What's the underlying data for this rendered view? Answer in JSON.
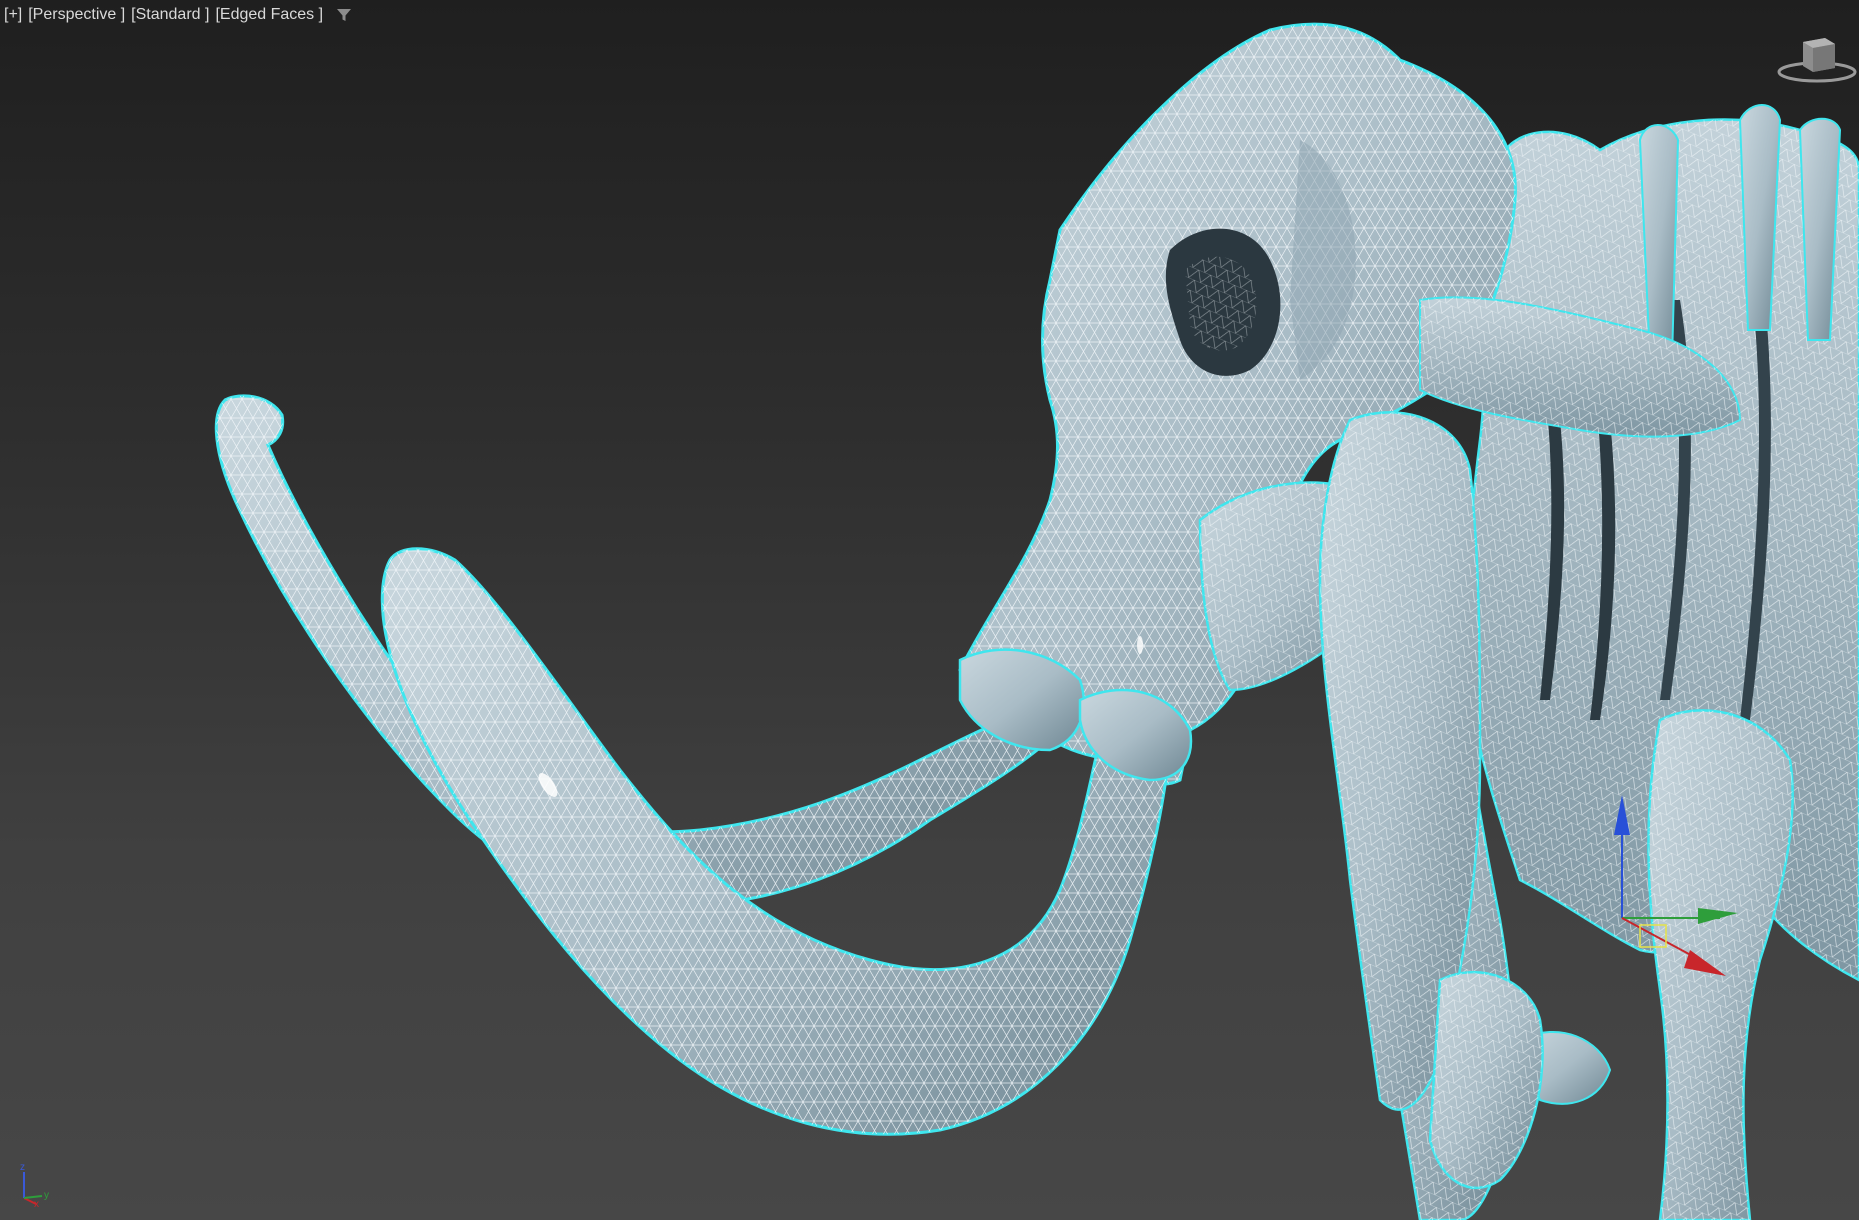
{
  "viewport": {
    "labels": {
      "plus": "[+]",
      "view": "[Perspective ]",
      "shading": "[Standard ]",
      "display": "[Edged Faces ]"
    },
    "filter_icon": "funnel-filter-icon",
    "viewcube_icon": "viewcube-icon",
    "axis_tripod": {
      "z": "z",
      "x": "x",
      "y": "y"
    },
    "gizmo_axes": {
      "x": "x",
      "y": "y",
      "z": "z"
    }
  },
  "scene": {
    "object": "mammoth-skeleton-mesh",
    "selected": true
  },
  "colors": {
    "background_top": "#1f1f1f",
    "background_bottom": "#474747",
    "mesh_fill": "#b6c7d0",
    "mesh_shadow": "#7f95a1",
    "wire": "#f2f7fa",
    "selection_outline": "#3fe6ee",
    "axis_x": "#c8262b",
    "axis_y": "#2e9e3b",
    "axis_z": "#2850d8"
  }
}
